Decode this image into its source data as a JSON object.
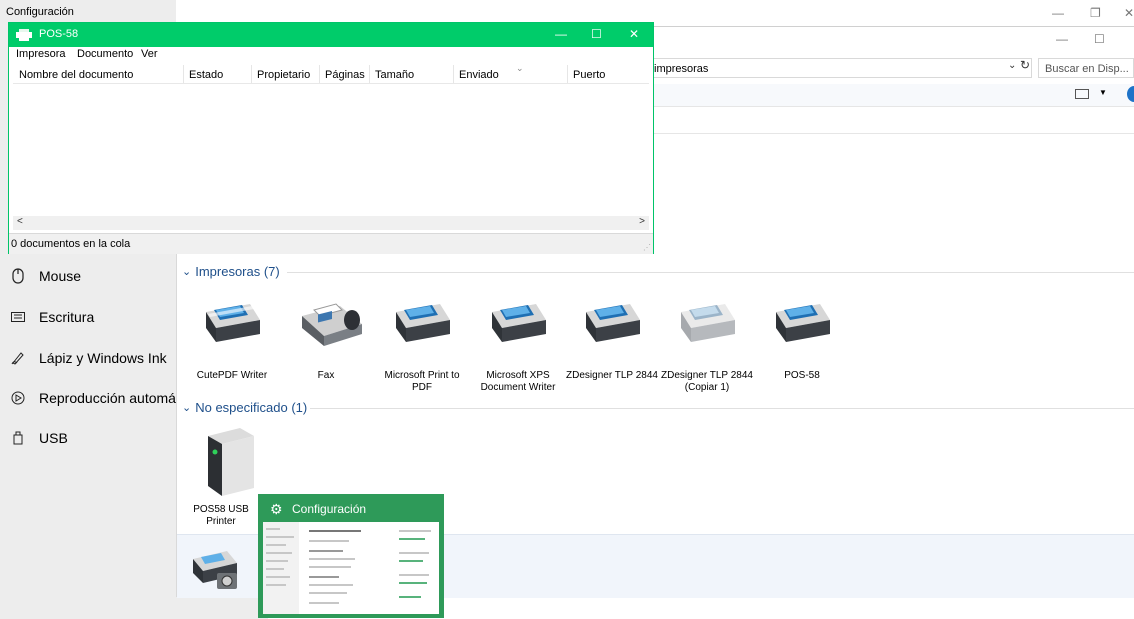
{
  "settings": {
    "title": "Configuración",
    "items": [
      {
        "label": "Mouse",
        "icon": "mouse-icon"
      },
      {
        "label": "Escritura",
        "icon": "keyboard-icon"
      },
      {
        "label": "Lápiz y Windows Ink",
        "icon": "pen-icon"
      },
      {
        "label": "Reproducción automática",
        "icon": "autoplay-icon"
      },
      {
        "label": "USB",
        "icon": "usb-icon"
      }
    ]
  },
  "devices_window": {
    "address": "impresoras",
    "search_placeholder": "Buscar en Disp...",
    "groups": [
      {
        "header": "Impresoras (7)",
        "devices": [
          "CutePDF Writer",
          "Fax",
          "Microsoft Print to PDF",
          "Microsoft XPS Document Writer",
          "ZDesigner TLP 2844",
          "ZDesigner TLP 2844 (Copiar 1)",
          "POS-58"
        ]
      },
      {
        "header": "No especificado (1)",
        "devices": [
          "POS58 USB Printer"
        ]
      }
    ]
  },
  "queue_window": {
    "title": "POS-58",
    "menu": [
      "Impresora",
      "Documento",
      "Ver"
    ],
    "columns": [
      "Nombre del documento",
      "Estado",
      "Propietario",
      "Páginas",
      "Tamaño",
      "Enviado",
      "Puerto"
    ],
    "status": "0 documentos en la cola"
  },
  "thumbnail": {
    "title": "Configuración"
  },
  "colors": {
    "queue_titlebar": "#00cc6a",
    "thumbnail_bg": "#2e9a59",
    "group_header": "#1e4f8a",
    "settings_bg": "#ededed"
  }
}
